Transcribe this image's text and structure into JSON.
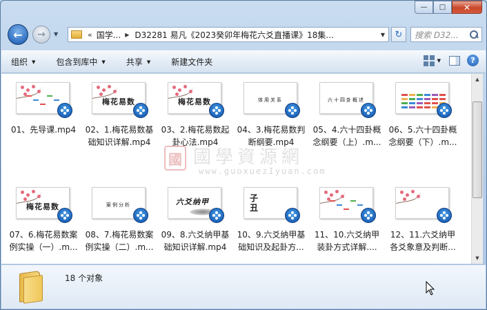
{
  "window": {
    "caption_buttons": {
      "minimize": "—",
      "maximize": "□",
      "close": "✕"
    }
  },
  "navigation": {
    "back_icon": "back-arrow-icon",
    "forward_icon": "forward-arrow-icon",
    "address": {
      "overflow": "«",
      "segments": [
        "国学...",
        "D32281 易凡《2023癸卯年梅花六爻直播课》18集..."
      ]
    },
    "search_placeholder": "搜索 D32..."
  },
  "toolbar": {
    "items": [
      "组织",
      "包含到库中",
      "共享",
      "新建文件夹"
    ]
  },
  "files": [
    {
      "label": "01、先导课.mp4",
      "thumb": "slide",
      "title": ""
    },
    {
      "label": "02、1.梅花易数基础知识详解.mp4",
      "thumb": "blossom",
      "title": "梅花易数"
    },
    {
      "label": "03、2.梅花易数起卦心法.mp4",
      "thumb": "blossom",
      "title": "梅花易数"
    },
    {
      "label": "04、3.梅花易数判断纲要.mp4",
      "thumb": "text",
      "title": "体用关系"
    },
    {
      "label": "05、4.六十四卦概念纲要（上）.m...",
      "thumb": "text",
      "title": "六十四卦概述"
    },
    {
      "label": "06、5.六十四卦概念纲要（下）.m...",
      "thumb": "chart",
      "title": ""
    },
    {
      "label": "07、6.梅花易数案例实操（一）.m...",
      "thumb": "blossom",
      "title": "梅花易数"
    },
    {
      "label": "08、7.梅花易数案例实操（二）.m...",
      "thumb": "text",
      "title": "案例分析"
    },
    {
      "label": "09、8.六爻纳甲基础知识详解.mp4",
      "thumb": "ink",
      "title": "六爻纳甲"
    },
    {
      "label": "10、9.六爻纳甲基础知识及起卦方...",
      "thumb": "glyph",
      "title": "子丑"
    },
    {
      "label": "11、10.六爻纳甲装卦方式详解....",
      "thumb": "diagram",
      "title": ""
    },
    {
      "label": "12、11.六爻纳甲各爻象意及判断...",
      "thumb": "blossom2",
      "title": ""
    }
  ],
  "watermark": {
    "chinese": "國學資源網",
    "url": "www.guoxuezIyuan.com",
    "seal": "國"
  },
  "status": {
    "count_text": "18 个对象"
  }
}
